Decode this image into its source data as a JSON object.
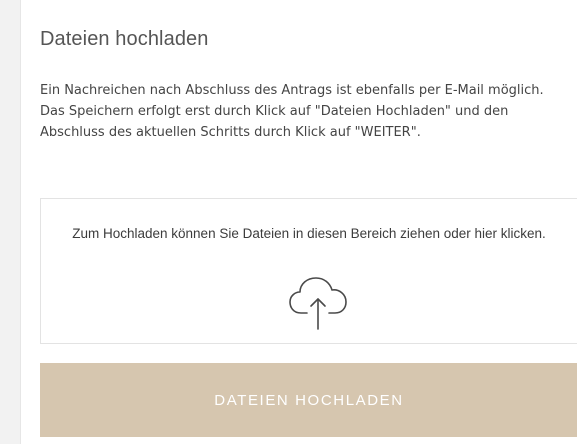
{
  "upload_section": {
    "title": "Dateien hochladen",
    "description": "Ein Nachreichen nach Abschluss des Antrags ist ebenfalls per E-Mail möglich. Das Speichern erfolgt erst durch Klick auf \"Dateien Hochladen\" und den Abschluss des aktuellen Schritts durch Klick auf \"WEITER\".",
    "dropzone": {
      "text": "Zum Hochladen können Sie Dateien in diesen Bereich ziehen oder hier klicken.",
      "icon": "cloud-upload-icon"
    },
    "upload_button_label": "DATEIEN HOCHLADEN"
  },
  "colors": {
    "button_background": "#d6c6af",
    "button_text": "#ffffff",
    "title_text": "#555555",
    "body_text": "#444444",
    "border": "#e3e3e3",
    "page_background": "#f2f2f2"
  }
}
